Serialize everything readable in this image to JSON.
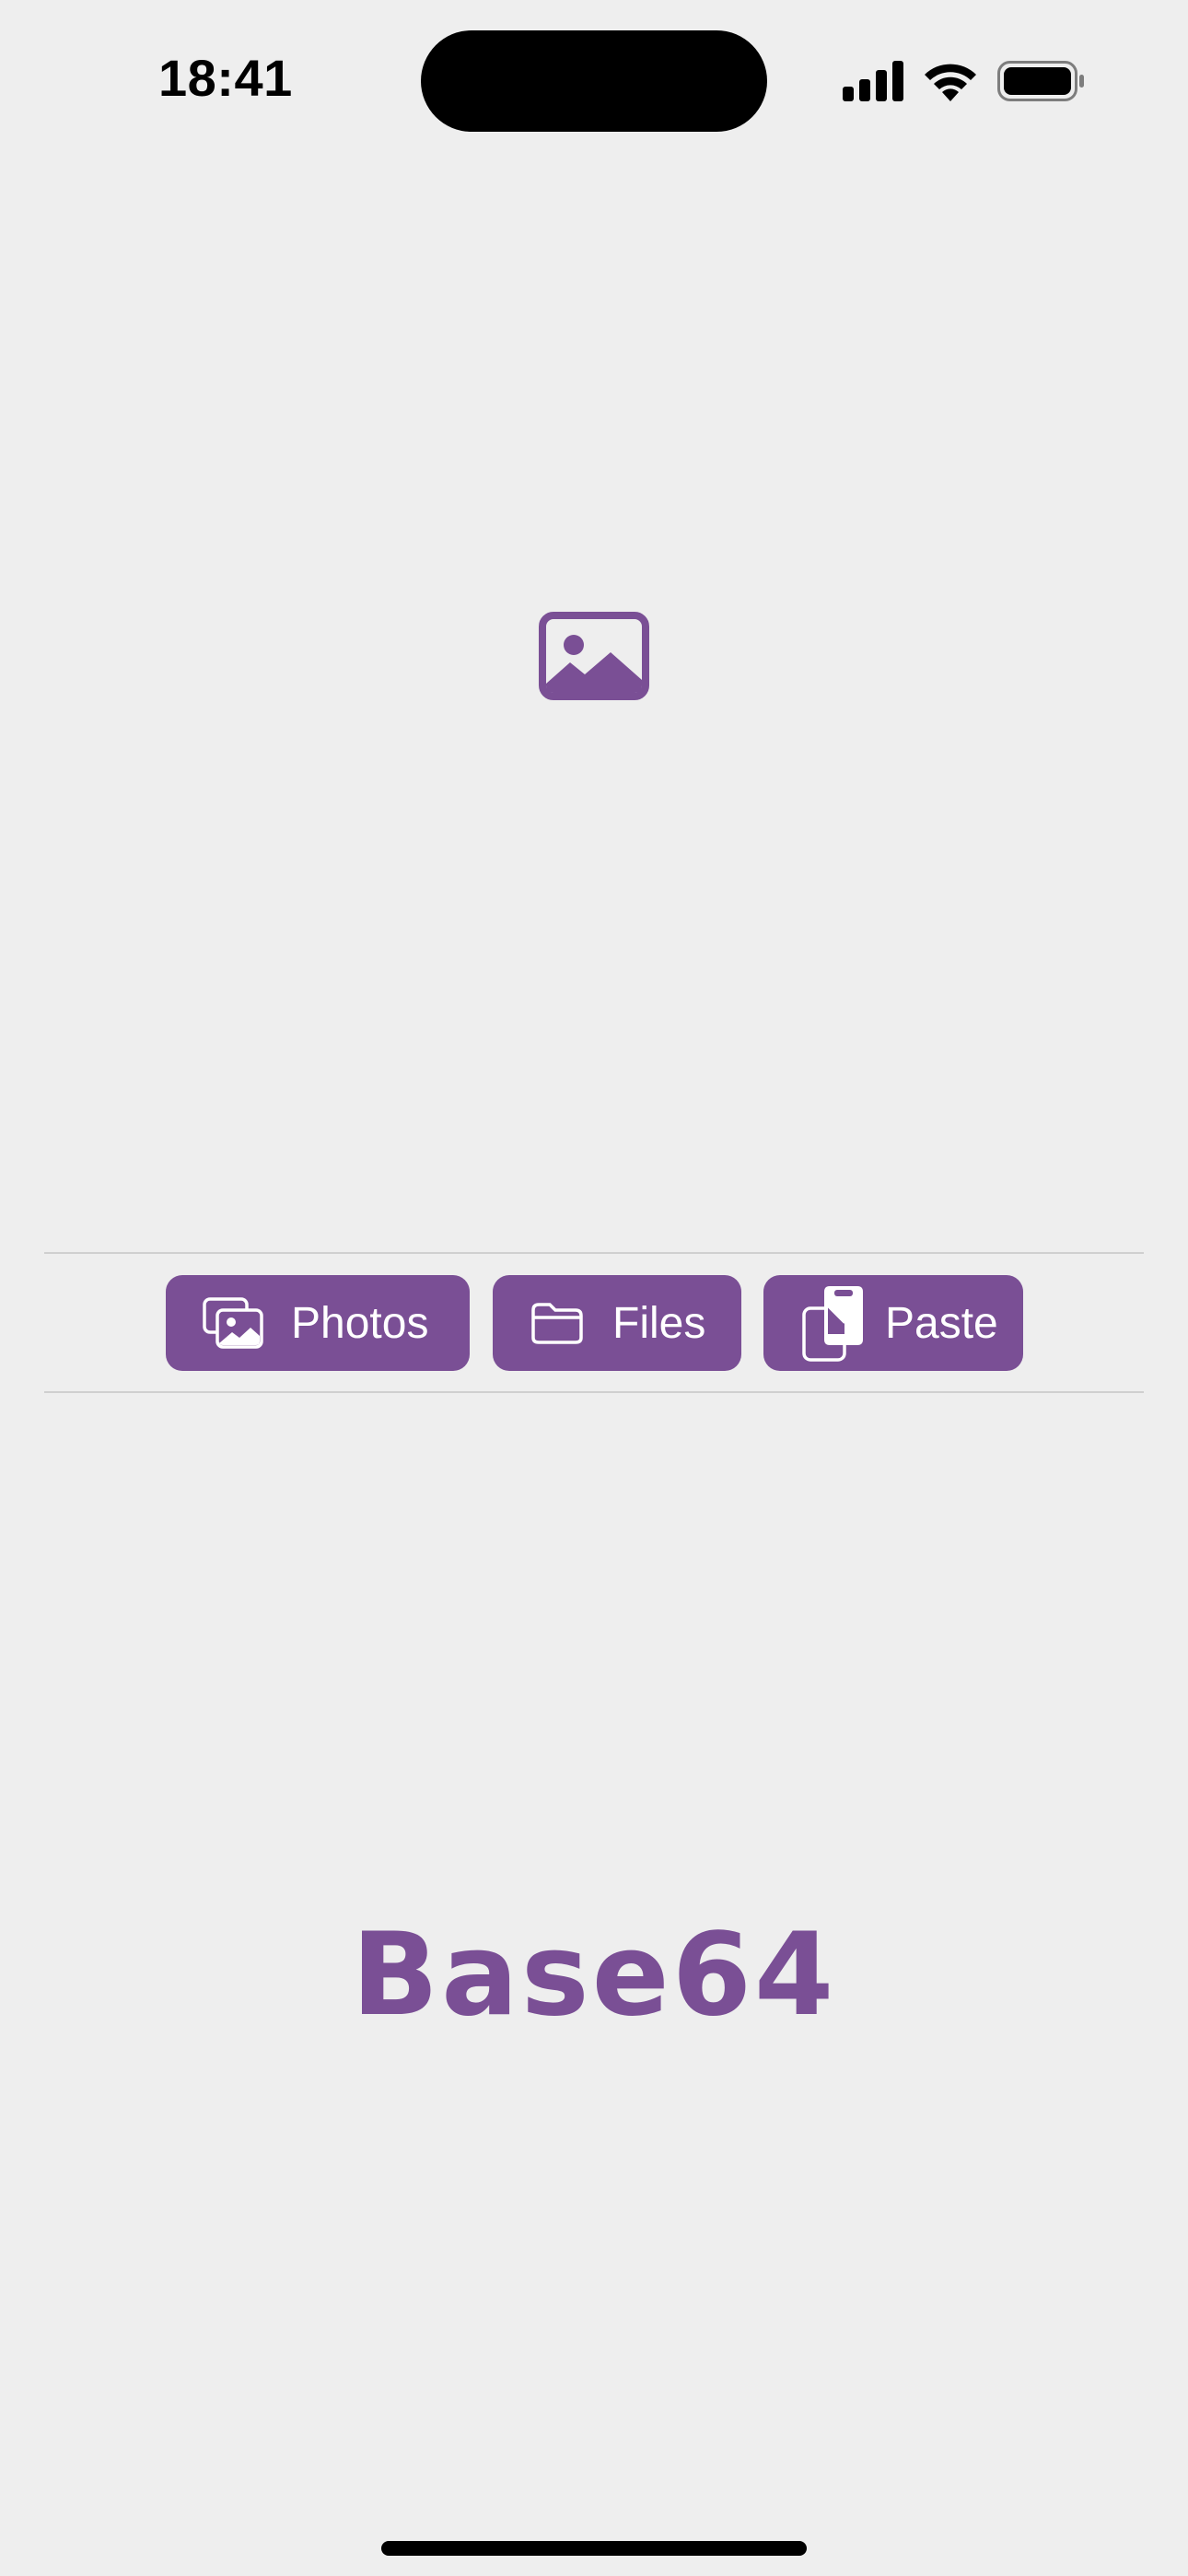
{
  "status_bar": {
    "time": "18:41",
    "icons": [
      "cellular-signal-icon",
      "wifi-icon",
      "battery-icon"
    ]
  },
  "preview": {
    "placeholder_icon": "photo-icon"
  },
  "toolbar": {
    "photos": {
      "label": "Photos",
      "icon": "photo-stack-icon"
    },
    "files": {
      "label": "Files",
      "icon": "folder-icon"
    },
    "paste": {
      "label": "Paste",
      "icon": "clipboard-paste-icon"
    }
  },
  "output": {
    "title": "Base64"
  },
  "colors": {
    "accent": "#7a4f95",
    "background": "#eeeeee",
    "divider": "#cfcfcf"
  }
}
